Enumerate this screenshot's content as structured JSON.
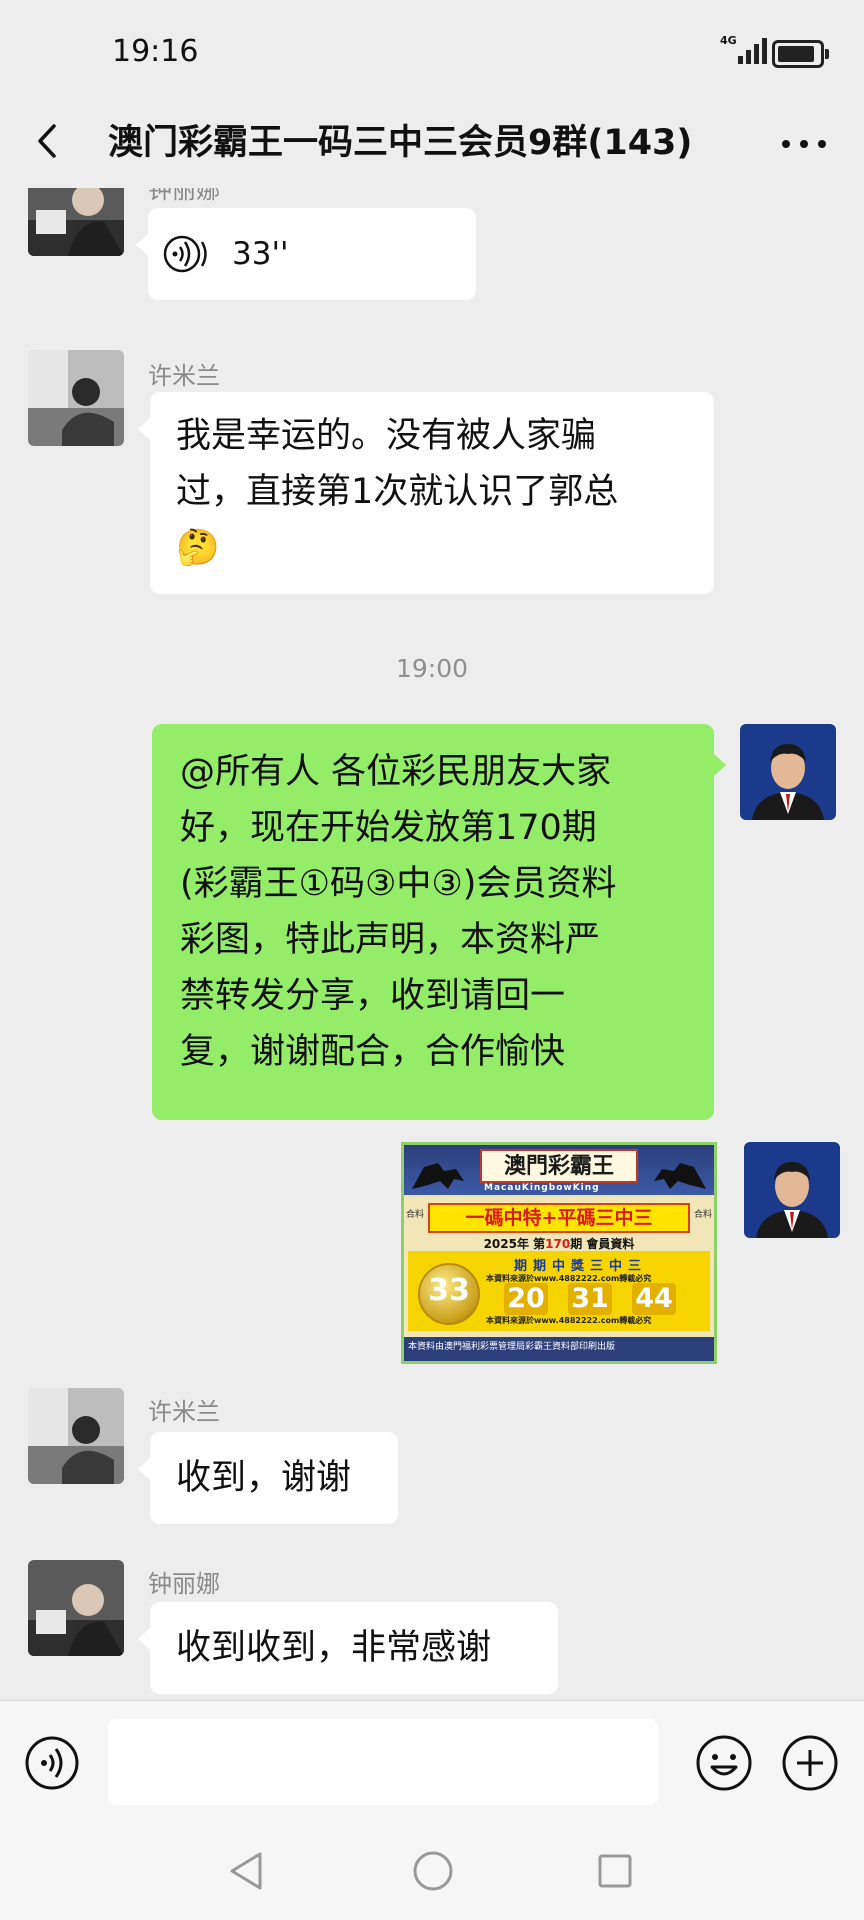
{
  "status_bar": {
    "time": "19:16",
    "network": "4G",
    "battery_level": 0.9
  },
  "header": {
    "title": "澳门彩霸王一码三中三会员9群(143)"
  },
  "messages": [
    {
      "sender": "钟丽娜",
      "type": "voice",
      "duration": "33''"
    },
    {
      "sender": "许米兰",
      "lines": [
        "我是幸运的。没有被人家骗",
        "过，直接第1次就认识了郭总"
      ],
      "emoji": "🤔"
    },
    {
      "timestamp": "19:00"
    },
    {
      "sender": "self",
      "lines": [
        "@所有人 各位彩民朋友大家",
        "好，现在开始发放第170期",
        "(彩霸王①码③中③)会员资料",
        "彩图，特此声明，本资料严",
        "禁转发分享，收到请回一",
        "复，谢谢配合，合作愉快"
      ]
    },
    {
      "sender": "self",
      "type": "image",
      "poster": {
        "title": "澳門彩霸王",
        "subtitle_en": "MacauKingbowKing",
        "band": "一碼中特+平碼三中三",
        "corner_left": "合料",
        "corner_right": "合料",
        "year_line_a": "2025年  第",
        "issue": "170",
        "year_line_b": "期  會員資料",
        "slogan": "期期中獎三中三",
        "special_number": "33",
        "numbers": [
          "20",
          "31",
          "44"
        ],
        "website_top": "本資料來源於www.4882222.com轉載必究",
        "website_bottom": "本資料來源於www.4882222.com轉載必究",
        "footer": "本資料由澳門福利彩票管理局彩霸王資料部印刷出版"
      }
    },
    {
      "sender": "许米兰",
      "text": "收到，谢谢"
    },
    {
      "sender": "钟丽娜",
      "text": "收到收到，非常感谢"
    }
  ],
  "input": {
    "placeholder": ""
  },
  "icons": {
    "back": "chevron-left-icon",
    "more": "more-icon",
    "voice": "voice-icon",
    "emoji": "emoji-icon",
    "plus": "plus-icon",
    "nav_back": "triangle-back-icon",
    "nav_home": "circle-home-icon",
    "nav_recent": "square-recent-icon"
  },
  "colors": {
    "outgoing_bubble": "#95ec69",
    "incoming_bubble": "#ffffff",
    "background": "#ededed"
  }
}
